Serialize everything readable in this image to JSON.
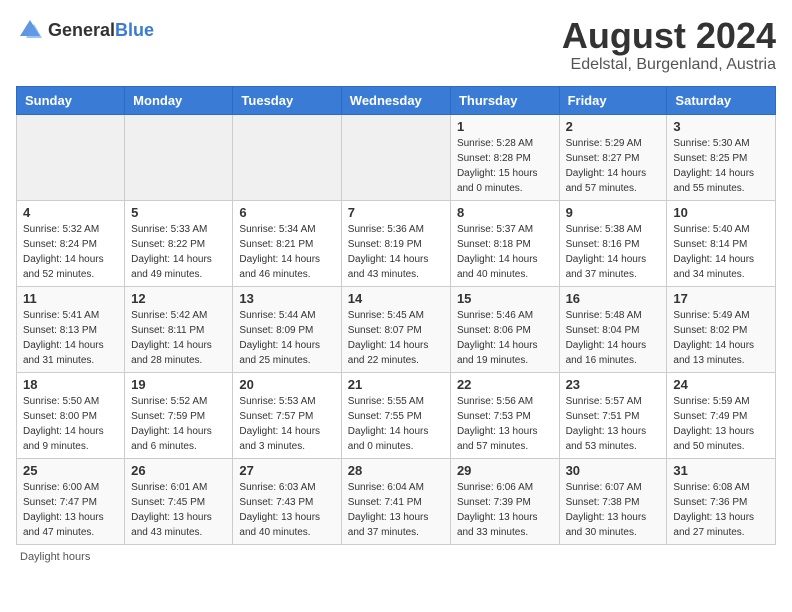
{
  "header": {
    "logo_general": "General",
    "logo_blue": "Blue",
    "main_title": "August 2024",
    "subtitle": "Edelstal, Burgenland, Austria"
  },
  "calendar": {
    "weekdays": [
      "Sunday",
      "Monday",
      "Tuesday",
      "Wednesday",
      "Thursday",
      "Friday",
      "Saturday"
    ],
    "weeks": [
      [
        {
          "day": "",
          "info": ""
        },
        {
          "day": "",
          "info": ""
        },
        {
          "day": "",
          "info": ""
        },
        {
          "day": "",
          "info": ""
        },
        {
          "day": "1",
          "info": "Sunrise: 5:28 AM\nSunset: 8:28 PM\nDaylight: 15 hours and 0 minutes."
        },
        {
          "day": "2",
          "info": "Sunrise: 5:29 AM\nSunset: 8:27 PM\nDaylight: 14 hours and 57 minutes."
        },
        {
          "day": "3",
          "info": "Sunrise: 5:30 AM\nSunset: 8:25 PM\nDaylight: 14 hours and 55 minutes."
        }
      ],
      [
        {
          "day": "4",
          "info": "Sunrise: 5:32 AM\nSunset: 8:24 PM\nDaylight: 14 hours and 52 minutes."
        },
        {
          "day": "5",
          "info": "Sunrise: 5:33 AM\nSunset: 8:22 PM\nDaylight: 14 hours and 49 minutes."
        },
        {
          "day": "6",
          "info": "Sunrise: 5:34 AM\nSunset: 8:21 PM\nDaylight: 14 hours and 46 minutes."
        },
        {
          "day": "7",
          "info": "Sunrise: 5:36 AM\nSunset: 8:19 PM\nDaylight: 14 hours and 43 minutes."
        },
        {
          "day": "8",
          "info": "Sunrise: 5:37 AM\nSunset: 8:18 PM\nDaylight: 14 hours and 40 minutes."
        },
        {
          "day": "9",
          "info": "Sunrise: 5:38 AM\nSunset: 8:16 PM\nDaylight: 14 hours and 37 minutes."
        },
        {
          "day": "10",
          "info": "Sunrise: 5:40 AM\nSunset: 8:14 PM\nDaylight: 14 hours and 34 minutes."
        }
      ],
      [
        {
          "day": "11",
          "info": "Sunrise: 5:41 AM\nSunset: 8:13 PM\nDaylight: 14 hours and 31 minutes."
        },
        {
          "day": "12",
          "info": "Sunrise: 5:42 AM\nSunset: 8:11 PM\nDaylight: 14 hours and 28 minutes."
        },
        {
          "day": "13",
          "info": "Sunrise: 5:44 AM\nSunset: 8:09 PM\nDaylight: 14 hours and 25 minutes."
        },
        {
          "day": "14",
          "info": "Sunrise: 5:45 AM\nSunset: 8:07 PM\nDaylight: 14 hours and 22 minutes."
        },
        {
          "day": "15",
          "info": "Sunrise: 5:46 AM\nSunset: 8:06 PM\nDaylight: 14 hours and 19 minutes."
        },
        {
          "day": "16",
          "info": "Sunrise: 5:48 AM\nSunset: 8:04 PM\nDaylight: 14 hours and 16 minutes."
        },
        {
          "day": "17",
          "info": "Sunrise: 5:49 AM\nSunset: 8:02 PM\nDaylight: 14 hours and 13 minutes."
        }
      ],
      [
        {
          "day": "18",
          "info": "Sunrise: 5:50 AM\nSunset: 8:00 PM\nDaylight: 14 hours and 9 minutes."
        },
        {
          "day": "19",
          "info": "Sunrise: 5:52 AM\nSunset: 7:59 PM\nDaylight: 14 hours and 6 minutes."
        },
        {
          "day": "20",
          "info": "Sunrise: 5:53 AM\nSunset: 7:57 PM\nDaylight: 14 hours and 3 minutes."
        },
        {
          "day": "21",
          "info": "Sunrise: 5:55 AM\nSunset: 7:55 PM\nDaylight: 14 hours and 0 minutes."
        },
        {
          "day": "22",
          "info": "Sunrise: 5:56 AM\nSunset: 7:53 PM\nDaylight: 13 hours and 57 minutes."
        },
        {
          "day": "23",
          "info": "Sunrise: 5:57 AM\nSunset: 7:51 PM\nDaylight: 13 hours and 53 minutes."
        },
        {
          "day": "24",
          "info": "Sunrise: 5:59 AM\nSunset: 7:49 PM\nDaylight: 13 hours and 50 minutes."
        }
      ],
      [
        {
          "day": "25",
          "info": "Sunrise: 6:00 AM\nSunset: 7:47 PM\nDaylight: 13 hours and 47 minutes."
        },
        {
          "day": "26",
          "info": "Sunrise: 6:01 AM\nSunset: 7:45 PM\nDaylight: 13 hours and 43 minutes."
        },
        {
          "day": "27",
          "info": "Sunrise: 6:03 AM\nSunset: 7:43 PM\nDaylight: 13 hours and 40 minutes."
        },
        {
          "day": "28",
          "info": "Sunrise: 6:04 AM\nSunset: 7:41 PM\nDaylight: 13 hours and 37 minutes."
        },
        {
          "day": "29",
          "info": "Sunrise: 6:06 AM\nSunset: 7:39 PM\nDaylight: 13 hours and 33 minutes."
        },
        {
          "day": "30",
          "info": "Sunrise: 6:07 AM\nSunset: 7:38 PM\nDaylight: 13 hours and 30 minutes."
        },
        {
          "day": "31",
          "info": "Sunrise: 6:08 AM\nSunset: 7:36 PM\nDaylight: 13 hours and 27 minutes."
        }
      ]
    ]
  },
  "footer": {
    "note": "Daylight hours"
  }
}
